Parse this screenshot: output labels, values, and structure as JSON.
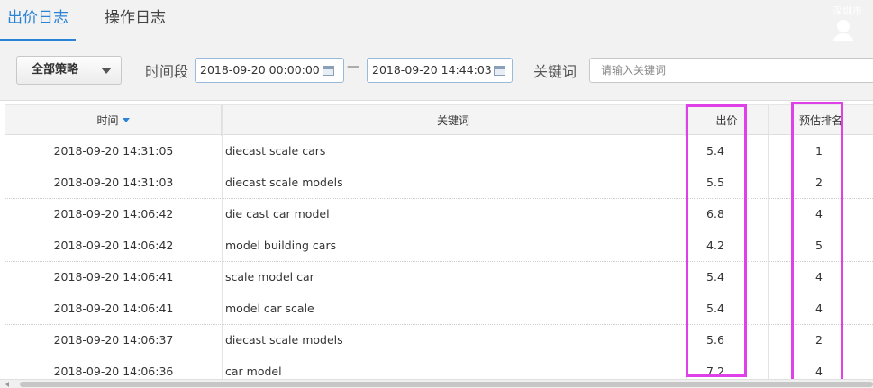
{
  "header": {
    "tabs": [
      {
        "label": "出价日志",
        "active": true
      },
      {
        "label": "操作日志",
        "active": false
      }
    ],
    "company_text": "深圳市"
  },
  "filters": {
    "strategy_label": "全部策略",
    "range_label": "时间段",
    "start_date": "2018-09-20 00:00:00",
    "separator": "—",
    "end_date": "2018-09-20 14:44:03",
    "keyword_label": "关键词",
    "keyword_placeholder": "请输入关键词"
  },
  "table": {
    "columns": {
      "time": "时间",
      "keyword": "关键词",
      "bid": "出价",
      "rank": "预估排名"
    },
    "rows": [
      {
        "time": "2018-09-20 14:31:05",
        "keyword": "diecast scale cars",
        "bid": "5.4",
        "rank": "1"
      },
      {
        "time": "2018-09-20 14:31:03",
        "keyword": "diecast scale models",
        "bid": "5.5",
        "rank": "2"
      },
      {
        "time": "2018-09-20 14:06:42",
        "keyword": "die cast car model",
        "bid": "6.8",
        "rank": "4"
      },
      {
        "time": "2018-09-20 14:06:42",
        "keyword": "model building cars",
        "bid": "4.2",
        "rank": "5"
      },
      {
        "time": "2018-09-20 14:06:41",
        "keyword": "scale model car",
        "bid": "5.4",
        "rank": "4"
      },
      {
        "time": "2018-09-20 14:06:41",
        "keyword": "model car scale",
        "bid": "5.4",
        "rank": "4"
      },
      {
        "time": "2018-09-20 14:06:37",
        "keyword": "diecast scale models",
        "bid": "5.6",
        "rank": "2"
      },
      {
        "time": "2018-09-20 14:06:36",
        "keyword": "car model",
        "bid": "7.2",
        "rank": "4"
      }
    ]
  },
  "colors": {
    "accent": "#2b83d6",
    "highlight": "#e040e8"
  }
}
